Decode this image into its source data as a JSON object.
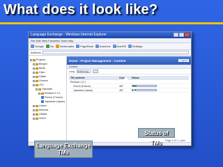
{
  "slide": {
    "title": "What does it look like?",
    "colors": {
      "background": "#2a5bd7",
      "title_rule": "#f3c300",
      "callout": "#9fb0bd"
    }
  },
  "browser": {
    "window_title": "Language Exchange - Windows Internet Explorer",
    "menu": "File  Edit  View  Favorites  Tools  Help",
    "toolbar": [
      {
        "label": "Google",
        "icon": "google-icon"
      },
      {
        "label": "Go",
        "icon": "go-icon"
      },
      {
        "label": "Bookmarks",
        "icon": "star-icon"
      },
      {
        "label": "PageRank",
        "icon": "pagerank-icon"
      },
      {
        "label": "AutoLink",
        "icon": "autolink-icon"
      },
      {
        "label": "AutoFill",
        "icon": "autofill-icon"
      },
      {
        "label": "Settings",
        "icon": "gear-icon"
      }
    ],
    "address_label": "Address"
  },
  "app": {
    "header": "Home : Project Management : Content",
    "logout": "Logout",
    "subheader": "Content",
    "filter_label": "Lang",
    "filter_value": "Swimming",
    "tree": [
      {
        "label": "Projects",
        "kind": "folder",
        "depth": 0
      },
      {
        "label": "Bergen",
        "kind": "folder",
        "depth": 1
      },
      {
        "label": "Berlin",
        "kind": "folder",
        "depth": 1
      },
      {
        "label": "Cairo",
        "kind": "folder",
        "depth": 1
      },
      {
        "label": "Dalian",
        "kind": "folder",
        "depth": 1
      },
      {
        "label": "Geneva",
        "kind": "folder",
        "depth": 1
      },
      {
        "label": "LEX",
        "kind": "folder",
        "depth": 1
      },
      {
        "label": "Translate",
        "kind": "folder",
        "depth": 2
      },
      {
        "label": "Revision 1.0.1",
        "kind": "folder",
        "depth": 3
      },
      {
        "label": "French (France)",
        "kind": "tm",
        "depth": 4
      },
      {
        "label": "Japanese (Japan)",
        "kind": "tm",
        "depth": 4
      },
      {
        "label": "Lisbon",
        "kind": "folder",
        "depth": 1
      },
      {
        "label": "Moscow",
        "kind": "folder",
        "depth": 1
      },
      {
        "label": "Ottawa",
        "kind": "folder",
        "depth": 1
      },
      {
        "label": "Zurich",
        "kind": "folder",
        "depth": 1
      }
    ],
    "table": {
      "columns": [
        "TM contents",
        "Count",
        "Status"
      ],
      "rows": [
        {
          "name": "Revision 1.0.1",
          "count": "",
          "status": null
        },
        {
          "name": "French (France)",
          "count": "487",
          "status": 0.18
        },
        {
          "name": "Japanese (Japan)",
          "count": "487",
          "status": 0.15
        }
      ]
    },
    "page_note": "Page 1 of 1 < prev"
  },
  "callouts": {
    "status": "Status of TMs",
    "lex_line1": "Language Exchange",
    "lex_line2": "TMs"
  }
}
